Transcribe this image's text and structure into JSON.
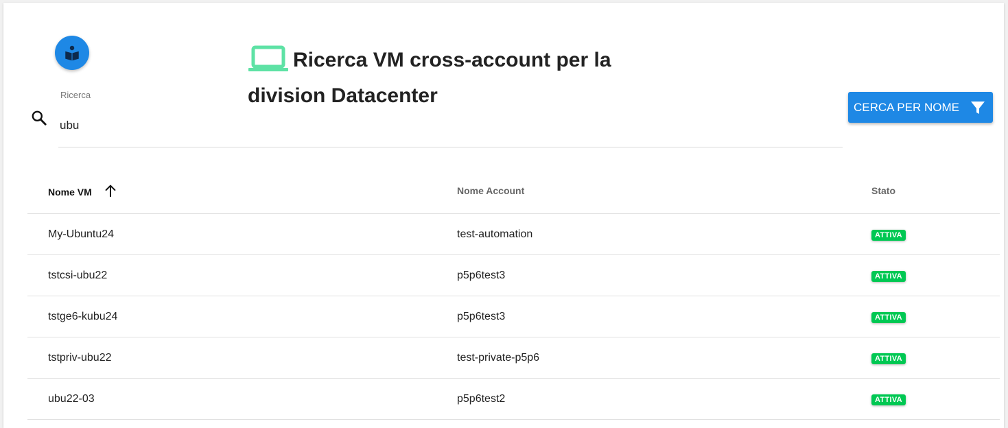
{
  "header": {
    "title": "Ricerca VM cross-account per la division Datacenter",
    "title_icon": "laptop-icon",
    "avatar_icon": "reading-person-icon"
  },
  "search": {
    "label": "Ricerca",
    "value": "ubu",
    "icon": "search-icon"
  },
  "filter_button": {
    "label": "CERCA PER NOME",
    "icon": "filter-icon"
  },
  "table": {
    "columns": [
      {
        "label": "Nome VM",
        "sort": "ascending"
      },
      {
        "label": "Nome Account"
      },
      {
        "label": "Stato"
      }
    ],
    "rows": [
      {
        "vm_name": "My-Ubuntu24",
        "account": "test-automation",
        "status": "ATTIVA"
      },
      {
        "vm_name": "tstcsi-ubu22",
        "account": "p5p6test3",
        "status": "ATTIVA"
      },
      {
        "vm_name": "tstge6-kubu24",
        "account": "p5p6test3",
        "status": "ATTIVA"
      },
      {
        "vm_name": "tstpriv-ubu22",
        "account": "test-private-p5p6",
        "status": "ATTIVA"
      },
      {
        "vm_name": "ubu22-03",
        "account": "p5p6test2",
        "status": "ATTIVA"
      }
    ]
  },
  "colors": {
    "primary": "#1e88e5",
    "status_active": "#00c853",
    "laptop_icon": "#5ee2a5"
  }
}
